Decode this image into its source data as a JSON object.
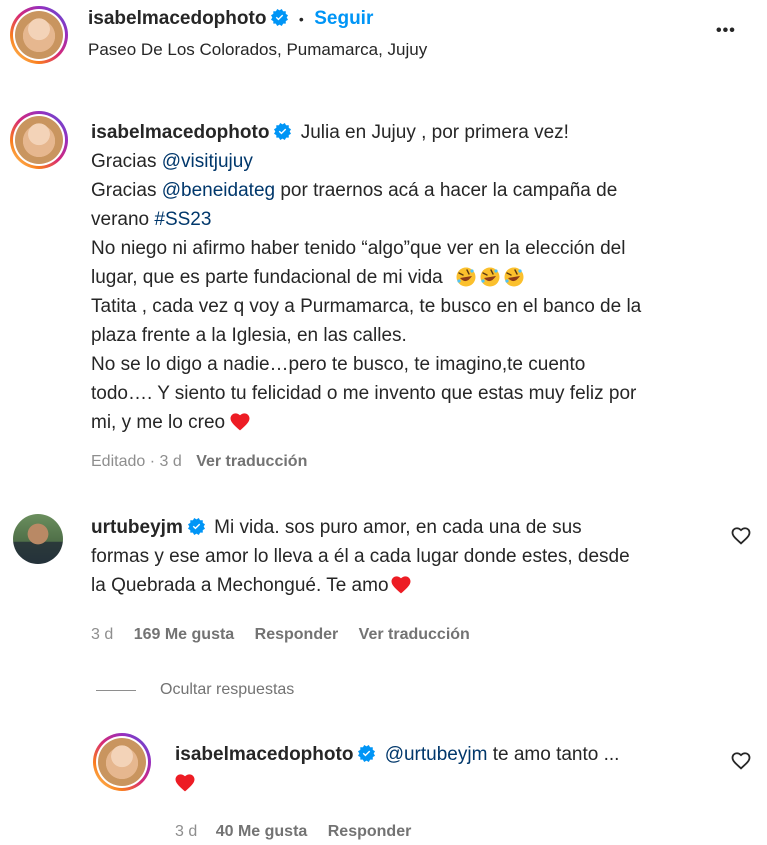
{
  "header": {
    "username": "isabelmacedophoto",
    "separator": "•",
    "follow_label": "Seguir",
    "location": "Paseo De Los Colorados, Pumamarca, Jujuy",
    "more_label": "•••"
  },
  "caption": {
    "username": "isabelmacedophoto",
    "line1": "Julia en Jujuy , por primera vez!",
    "thanks1_prefix": "Gracias ",
    "thanks1_mention": "@visitjujuy",
    "thanks2_prefix": "Gracias ",
    "thanks2_mention": "@beneidateg",
    "thanks2_suffix": " por traernos acá a hacer la campaña de",
    "line_verano_prefix": "verano ",
    "hashtag": "#SS23",
    "line_niego": "No niego ni afirmo haber tenido “algo”que ver en la elección del",
    "line_lugar": "lugar, que es parte fundacional de mi vida",
    "line_tatita": "Tatita , cada vez q voy a Purmamarca, te busco en el banco de la",
    "line_plaza": "plaza frente a la Iglesia, en las calles.",
    "line_nose": "No se lo digo a nadie…pero te busco, te imagino,te cuento",
    "line_todo": "todo…. Y siento tu felicidad o me invento que estas muy feliz por",
    "line_mi": "mi, y me lo creo",
    "meta_edited": "Editado · 3 d",
    "meta_translate": "Ver traducción"
  },
  "comment1": {
    "username": "urtubeyjm",
    "line1": "Mi vida. sos puro amor, en cada una de sus",
    "line2": "formas y ese amor lo lleva a él a cada lugar donde estes, desde",
    "line3": "la Quebrada a Mechongué. Te amo",
    "time": "3 d",
    "likes": "169 Me gusta",
    "reply": "Responder",
    "translate": "Ver traducción"
  },
  "replies_toggle": {
    "label": "Ocultar respuestas"
  },
  "reply1": {
    "username": "isabelmacedophoto",
    "mention": "@urtubeyjm",
    "text": " te amo tanto ...",
    "time": "3 d",
    "likes": "40 Me gusta",
    "reply": "Responder"
  },
  "icons": {
    "verified": "verified-badge-icon",
    "heart_filled": "red-heart-icon",
    "heart_outline": "like-heart-outline-icon",
    "emoji": "rolling-laughing-emoji-icon",
    "more": "more-options-icon"
  },
  "colors": {
    "accent_blue": "#0095f6",
    "link": "#00376b",
    "heart_red": "#ed1c24",
    "muted": "#8e8e8e"
  }
}
